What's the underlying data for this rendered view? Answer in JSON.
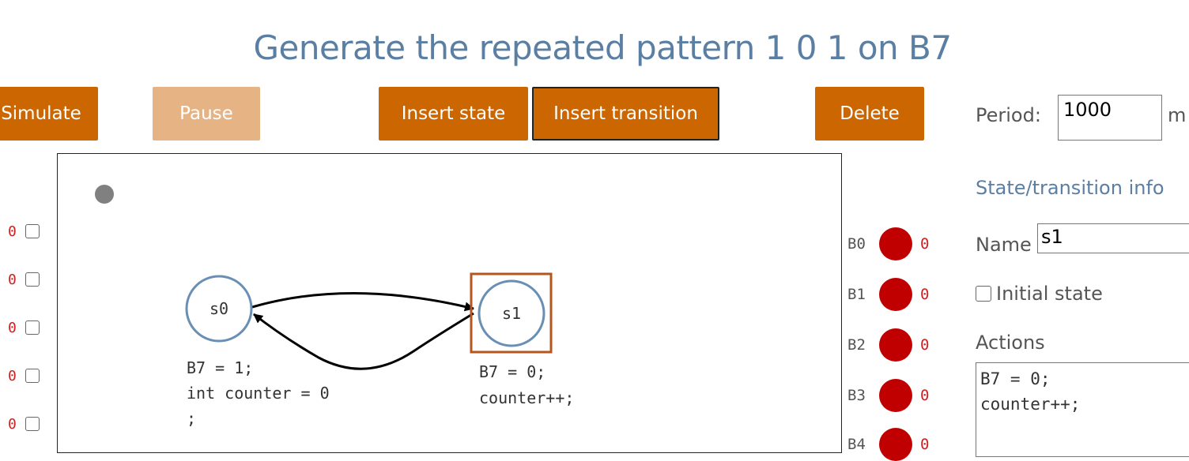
{
  "title": "Generate the repeated pattern 1 0 1 on B7",
  "toolbar": {
    "simulate": "Simulate",
    "pause": "Pause",
    "insert_state": "Insert state",
    "insert_transition": "Insert transition",
    "delete": "Delete"
  },
  "period": {
    "label": "Period:",
    "value": "1000",
    "unit": "m"
  },
  "inputs": [
    "0",
    "0",
    "0",
    "0",
    "0"
  ],
  "diagram": {
    "states": [
      {
        "name": "s0",
        "actions": [
          "B7 = 1;",
          "int counter = 0",
          ";"
        ]
      },
      {
        "name": "s1",
        "actions": [
          "B7 = 0;",
          "counter++;"
        ]
      }
    ]
  },
  "outputs": [
    {
      "label": "B0",
      "value": "0"
    },
    {
      "label": "B1",
      "value": "0"
    },
    {
      "label": "B2",
      "value": "0"
    },
    {
      "label": "B3",
      "value": "0"
    },
    {
      "label": "B4",
      "value": "0"
    }
  ],
  "info": {
    "section_title": "State/transition info",
    "name_label": "Name",
    "name_value": "s1",
    "initial_state_label": "Initial state",
    "actions_label": "Actions",
    "actions_value": "B7 = 0;\ncounter++;"
  },
  "colors": {
    "accent": "#cc6600",
    "accent_disabled": "#e6b385",
    "title": "#5b7fa3",
    "led": "#c00000",
    "value_text": "#cc2222",
    "state_circle": "#6a8fb4",
    "selected_box": "#b5561f"
  }
}
